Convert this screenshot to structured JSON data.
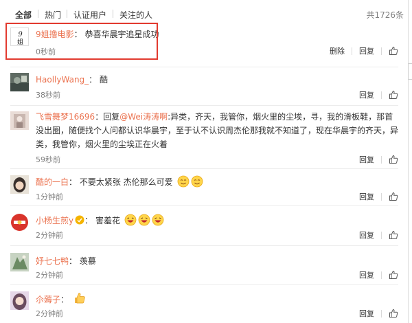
{
  "tabs": [
    {
      "label": "全部"
    },
    {
      "label": "热门"
    },
    {
      "label": "认证用户"
    },
    {
      "label": "关注的人"
    }
  ],
  "total_label": "共1726条",
  "actions": {
    "delete": "删除",
    "reply": "回复"
  },
  "comments": [
    {
      "user": "9姐撸电影",
      "sep": "：",
      "text": "恭喜华晨宇追星成功",
      "time": "0秒前",
      "avatar_text": "9姐"
    },
    {
      "user": "HaollyWang_",
      "sep": "：",
      "text": "酷",
      "time": "38秒前"
    },
    {
      "user": "飞雪舞梦16696",
      "sep": "：",
      "text_prefix": "回复",
      "mention": "@Wei涛涛啊",
      "text": ":异类，齐天，我管你，烟火里的尘埃，寻，我的滑板鞋，那首没出圈，随便找个人问都认识华晨宇，至于认不认识周杰伦那我就不知道了，现在华晨宇的齐天，异类，我管你，烟火里的尘埃正在火着",
      "time": "59秒前"
    },
    {
      "user": "酷的一白",
      "sep": "：",
      "text": "不要太紧张 杰伦那么可爱",
      "time": "1分钟前"
    },
    {
      "user": "小杨生煎y",
      "sep": "：",
      "text": "害羞花",
      "time": "2分钟前"
    },
    {
      "user": "妤七七鸭",
      "sep": "：",
      "text": "羡慕",
      "time": "2分钟前"
    },
    {
      "user": "尒薅子",
      "sep": "：",
      "text": "",
      "time": "2分钟前"
    }
  ],
  "colors": {
    "link": "#eb7350",
    "highlight": "#e23a2f",
    "meta": "#808080"
  }
}
